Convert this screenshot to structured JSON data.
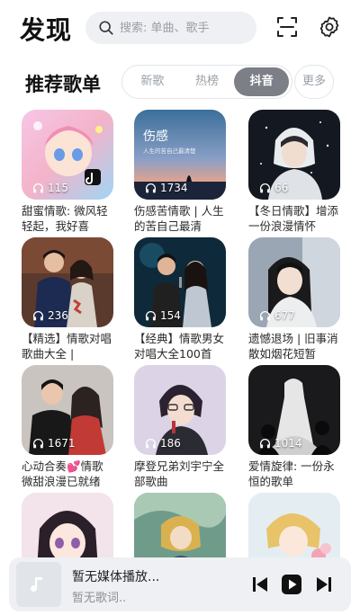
{
  "header": {
    "title": "发现",
    "search_placeholder": "搜索: 单曲、歌手"
  },
  "section": {
    "title": "推荐歌单",
    "tabs": [
      "新歌",
      "热榜",
      "抖音"
    ],
    "active_tab": "抖音",
    "more": "更多"
  },
  "playlists": [
    {
      "plays": "115",
      "title": "甜蜜情歌: 微风轻轻起，我好喜"
    },
    {
      "plays": "1734",
      "title": "伤感苦情歌 | 人生的苦自己最清",
      "cover_text": "伤感",
      "cover_subtext": "人生的苦自己最清楚"
    },
    {
      "plays": "66",
      "title": "【冬日情歌】增添一份浪漫情怀"
    },
    {
      "plays": "236",
      "title": "【精选】情歌对唱歌曲大全 |"
    },
    {
      "plays": "154",
      "title": "【经典】情歌男女对唱大全100首"
    },
    {
      "plays": "677",
      "title": "遗憾退场 | 旧事消散如烟花短暂"
    },
    {
      "plays": "1671",
      "title": "心动合奏💕情歌微甜浪漫已就绪"
    },
    {
      "plays": "186",
      "title": "摩登兄弟刘宇宁全部歌曲"
    },
    {
      "plays": "1014",
      "title": "爱情旋律: 一份永恒的歌单"
    },
    {
      "plays": "",
      "title": ""
    },
    {
      "plays": "",
      "title": ""
    },
    {
      "plays": "",
      "title": ""
    }
  ],
  "player": {
    "title": "暂无媒体播放...",
    "lyric": "暂无歌词.."
  },
  "colors": {
    "accent_tab": "#7c7f85",
    "search_bg": "#eef0f3",
    "player_bg": "#eef0f3"
  }
}
